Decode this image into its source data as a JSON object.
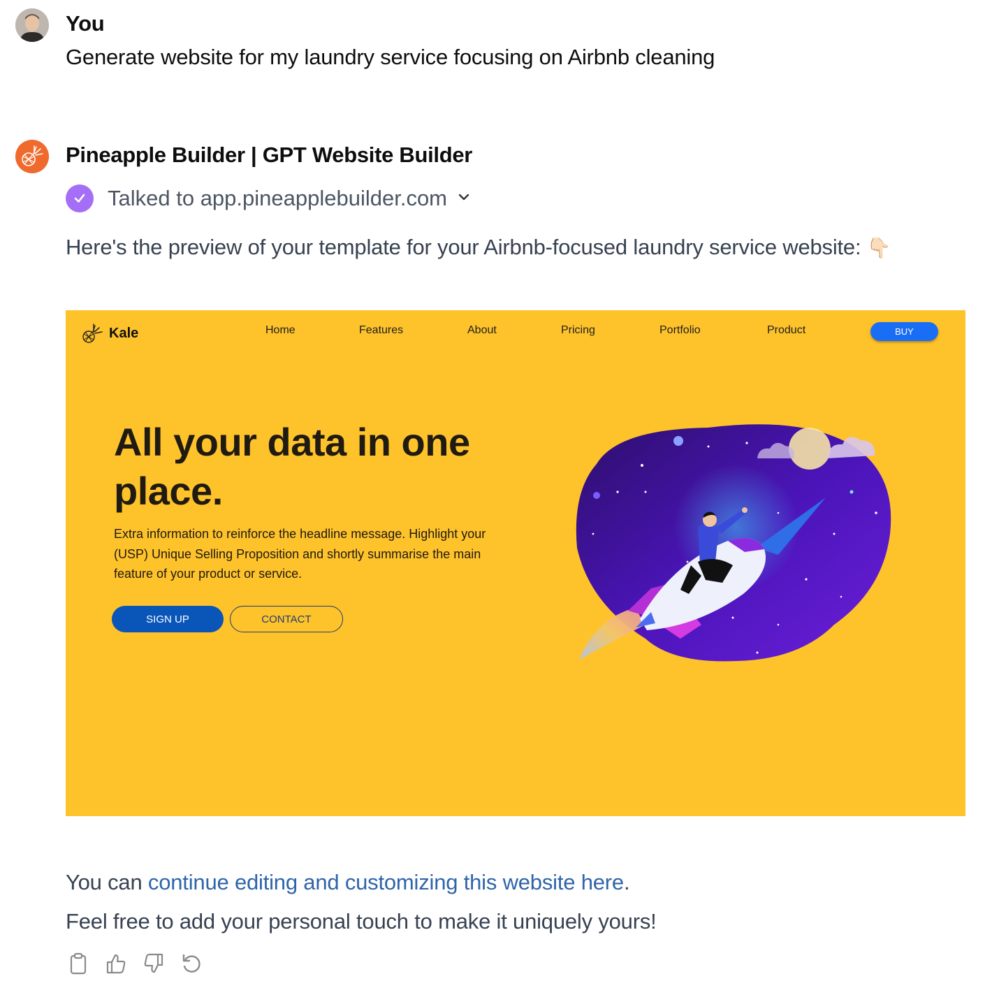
{
  "user": {
    "name": "You",
    "message": "Generate website for my laundry service focusing on Airbnb cleaning"
  },
  "assistant": {
    "name": "Pineapple Builder | GPT Website Builder",
    "tool_status": "Talked to app.pineapplebuilder.com",
    "intro": "Here's the preview of your template for your Airbnb-focused laundry service website:",
    "intro_emoji": "👇🏻",
    "outro_prefix": "You can ",
    "outro_link": "continue editing and customizing this website here",
    "outro_suffix": ".",
    "closing": "Feel free to add your personal touch to make it uniquely yours!"
  },
  "preview": {
    "background": "#fec22b",
    "brand": "Kale",
    "nav": [
      "Home",
      "Features",
      "About",
      "Pricing",
      "Portfolio",
      "Product"
    ],
    "buy_label": "BUY",
    "hero_title": "All your data in one place.",
    "hero_subtitle": "Extra information to reinforce the headline message. Highlight your (USP) Unique Selling Proposition and shortly summarise the main feature of your product or service.",
    "signup_label": "SIGN UP",
    "contact_label": "CONTACT"
  },
  "actions": [
    "copy-icon",
    "thumbs-up-icon",
    "thumbs-down-icon",
    "regenerate-icon"
  ]
}
